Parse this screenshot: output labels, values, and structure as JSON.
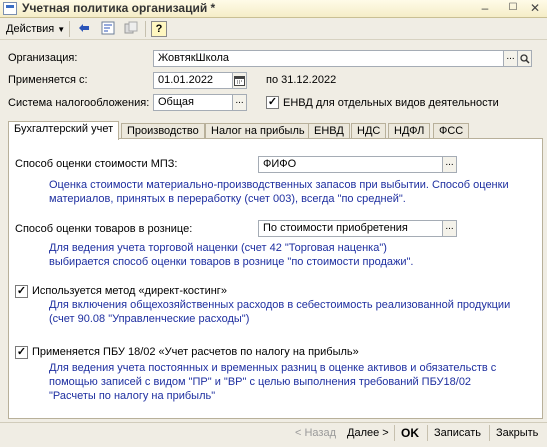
{
  "window": {
    "title": "Учетная политика организаций *"
  },
  "toolbar": {
    "actions_label": "Действия",
    "help_label": "?"
  },
  "form": {
    "organization_label": "Организация:",
    "organization_value": "ЖовтякШкола",
    "applies_label": "Применяется с:",
    "applies_date": "01.01.2022",
    "applies_to": "по 31.12.2022",
    "tax_label": "Система налогообложения:",
    "tax_value": "Общая",
    "envd_label": "ЕНВД для отдельных видов деятельности",
    "envd_checked": true
  },
  "tabs": [
    {
      "label": "Бухгалтерский учет"
    },
    {
      "label": "Производство"
    },
    {
      "label": "Налог на прибыль"
    },
    {
      "label": "ЕНВД"
    },
    {
      "label": "НДС"
    },
    {
      "label": "НДФЛ"
    },
    {
      "label": "ФСС"
    }
  ],
  "accounting": {
    "mpz_label": "Способ оценки стоимости МПЗ:",
    "mpz_value": "ФИФО",
    "mpz_desc": "Оценка стоимости материально-производственных запасов при выбытии. Способ оценки материалов, принятых в переработку (счет 003), всегда \"по средней\".",
    "retail_label": "Способ оценки товаров в рознице:",
    "retail_value": "По стоимости приобретения",
    "retail_desc": "Для ведения учета торговой наценки (счет 42 \"Торговая наценка\") выбирается способ оценки товаров в рознице \"по стоимости продажи\".",
    "direct_costing_label": "Используется метод «директ-костинг»",
    "direct_costing_checked": true,
    "direct_costing_desc": "Для включения общехозяйственных расходов в себестоимость реализованной продукции (счет 90.08 \"Управленческие расходы\")",
    "pbu_label": "Применяется ПБУ 18/02 «Учет расчетов по налогу на прибыль»",
    "pbu_checked": true,
    "pbu_desc": "Для ведения учета постоянных и временных разниц в оценке активов и обязательств с помощью записей с видом \"ПР\" и \"ВР\" с целью выполнения требований ПБУ18/02 \"Расчеты по налогу на прибыль\""
  },
  "footer": {
    "back_label": "< Назад",
    "next_label": "Далее >",
    "ok_label": "OK",
    "save_label": "Записать",
    "close_label": "Закрыть"
  },
  "colors": {
    "description_text": "#1e2fa0",
    "title_bar": "#f5edc7"
  }
}
